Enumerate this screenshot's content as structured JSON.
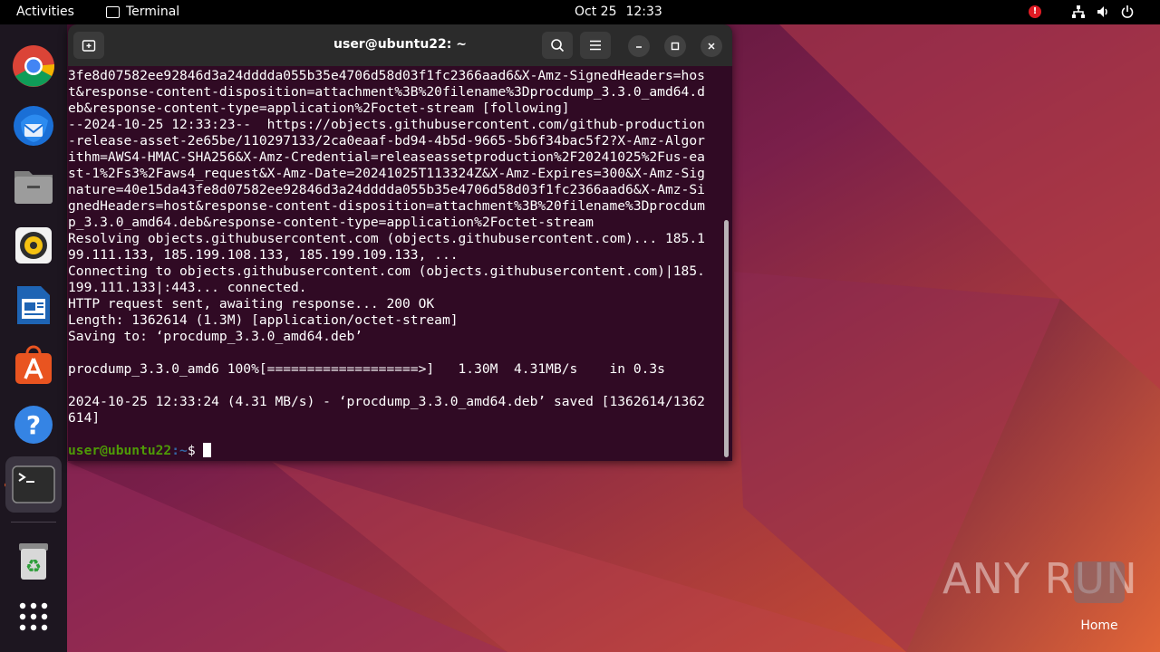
{
  "topbar": {
    "activities": "Activities",
    "app_name": "Terminal",
    "date": "Oct 25",
    "time": "12:33"
  },
  "dock": {
    "items": [
      "chrome-icon",
      "thunderbird-icon",
      "files-icon",
      "rhythmbox-icon",
      "writer-icon",
      "app-center-icon",
      "help-icon",
      "terminal-icon",
      "trash-icon",
      "show-apps-icon"
    ]
  },
  "terminal": {
    "title": "user@ubuntu22: ~",
    "lines": [
      "3fe8d07582ee92846d3a24dddda055b35e4706d58d03f1fc2366aad6&X-Amz-SignedHeaders=hos",
      "t&response-content-disposition=attachment%3B%20filename%3Dprocdump_3.3.0_amd64.d",
      "eb&response-content-type=application%2Foctet-stream [following]",
      "--2024-10-25 12:33:23--  https://objects.githubusercontent.com/github-production",
      "-release-asset-2e65be/110297133/2ca0eaaf-bd94-4b5d-9665-5b6f34bac5f2?X-Amz-Algor",
      "ithm=AWS4-HMAC-SHA256&X-Amz-Credential=releaseassetproduction%2F20241025%2Fus-ea",
      "st-1%2Fs3%2Faws4_request&X-Amz-Date=20241025T113324Z&X-Amz-Expires=300&X-Amz-Sig",
      "nature=40e15da43fe8d07582ee92846d3a24dddda055b35e4706d58d03f1fc2366aad6&X-Amz-Si",
      "gnedHeaders=host&response-content-disposition=attachment%3B%20filename%3Dprocdum",
      "p_3.3.0_amd64.deb&response-content-type=application%2Foctet-stream",
      "Resolving objects.githubusercontent.com (objects.githubusercontent.com)... 185.1",
      "99.111.133, 185.199.108.133, 185.199.109.133, ...",
      "Connecting to objects.githubusercontent.com (objects.githubusercontent.com)|185.",
      "199.111.133|:443... connected.",
      "HTTP request sent, awaiting response... 200 OK",
      "Length: 1362614 (1.3M) [application/octet-stream]",
      "Saving to: ‘procdump_3.3.0_amd64.deb’",
      "",
      "procdump_3.3.0_amd6 100%[===================>]   1.30M  4.31MB/s    in 0.3s",
      "",
      "2024-10-25 12:33:24 (4.31 MB/s) - ‘procdump_3.3.0_amd64.deb’ saved [1362614/1362",
      "614]",
      ""
    ],
    "prompt_user": "user@ubuntu22",
    "prompt_path": ":~",
    "prompt_symbol": "$ "
  },
  "watermark": "ANY RUN",
  "desktop": {
    "home_label": "Home"
  }
}
